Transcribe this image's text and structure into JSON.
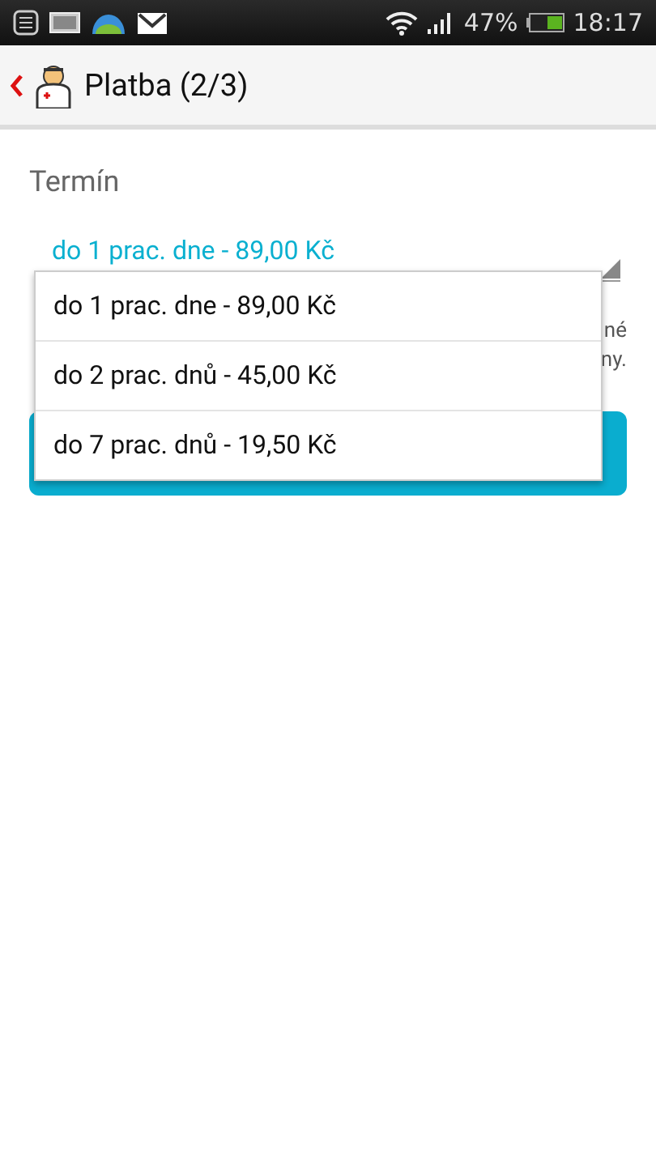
{
  "status_bar": {
    "battery": "47%",
    "time": "18:17"
  },
  "header": {
    "title": "Platba (2/3)"
  },
  "form": {
    "label": "Termín",
    "spinner": {
      "value": "do 1 prac. dne - 89,00 Kč",
      "expanded": true
    },
    "note_fragments": [
      "né",
      "ny."
    ],
    "dropdown": {
      "options": [
        {
          "label": "do 1 prac. dne - 89,00 Kč"
        },
        {
          "label": "do 2 prac. dnů - 45,00 Kč"
        },
        {
          "label": "do 7 prac. dnů - 19,50 Kč"
        }
      ]
    }
  }
}
